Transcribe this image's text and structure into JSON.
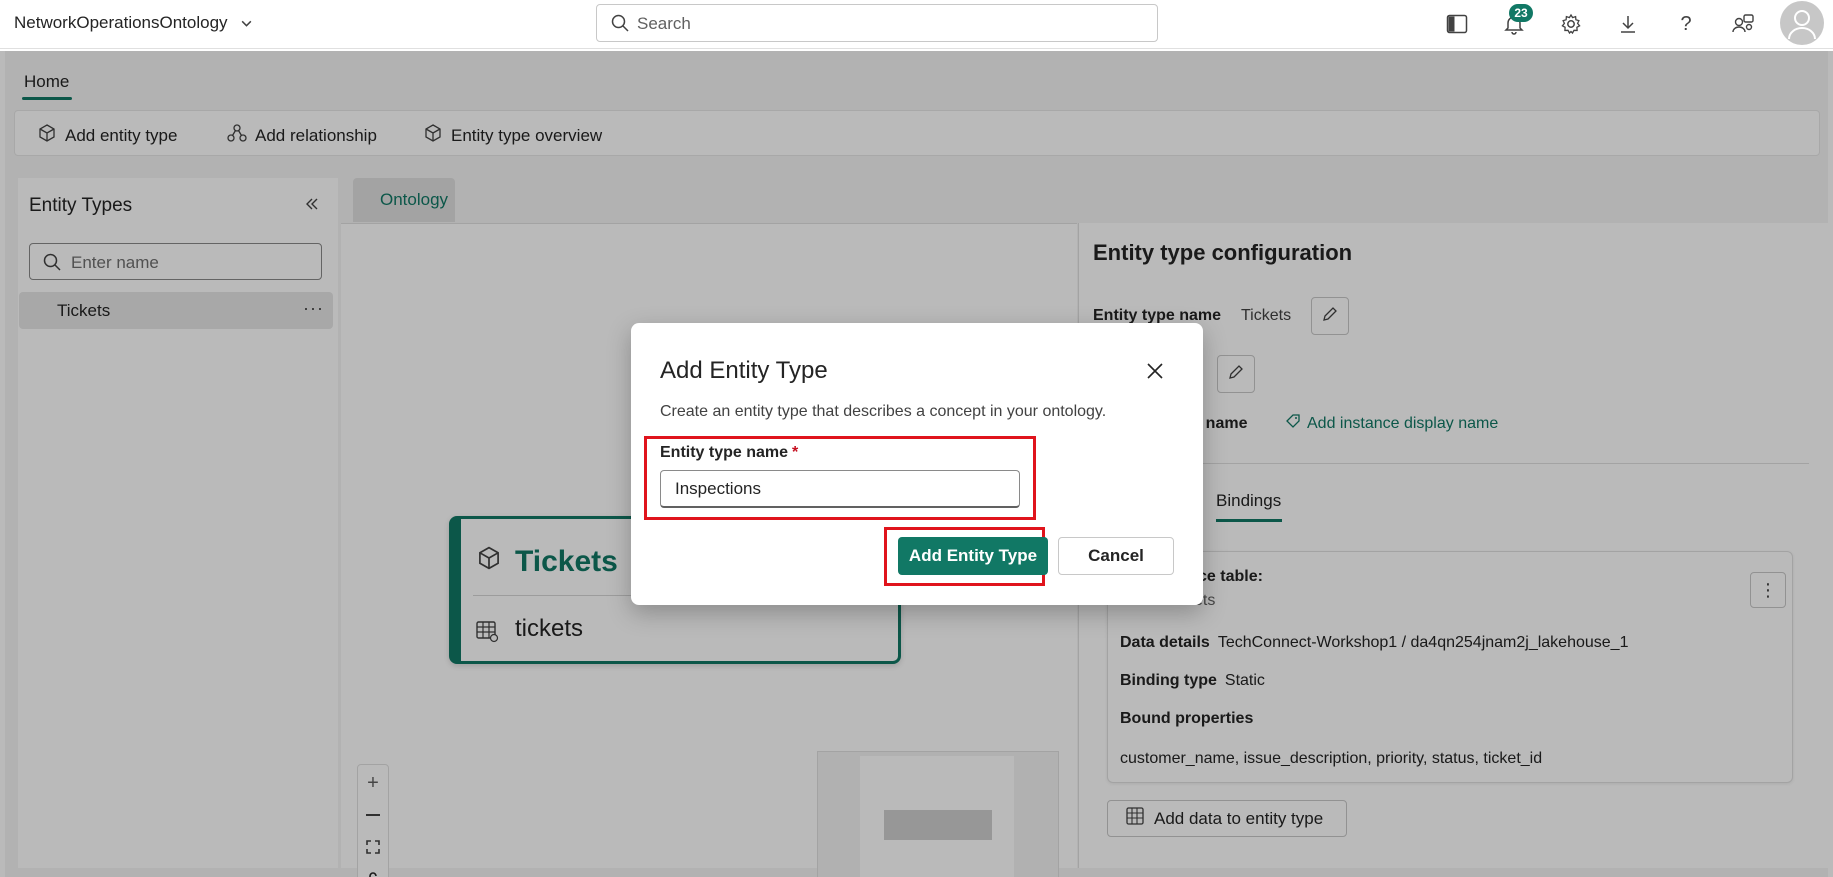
{
  "topbar": {
    "workspace_name": "NetworkOperationsOntology",
    "search_placeholder": "Search",
    "notification_count": "23",
    "icons": [
      "sidebar-toggle-icon",
      "bell-icon",
      "gear-icon",
      "download-icon",
      "help-icon",
      "share-people-icon",
      "avatar-icon"
    ]
  },
  "tabs": {
    "home": "Home"
  },
  "ribbon": {
    "add_entity_type": "Add entity type",
    "add_relationship": "Add relationship",
    "entity_type_overview": "Entity type overview"
  },
  "left_panel": {
    "title": "Entity Types",
    "search_placeholder": "Enter name",
    "items": [
      {
        "label": "Tickets",
        "more": "···"
      }
    ]
  },
  "canvas": {
    "tab_label": "Ontology",
    "node": {
      "title": "Tickets",
      "table": "tickets"
    }
  },
  "config": {
    "title": "Entity type configuration",
    "entity_type_name_label": "Entity type name",
    "entity_type_name_value": "Tickets",
    "display_name_label": "ty name",
    "add_display_name": "Add instance display name",
    "bindings_tab": "Bindings",
    "source_table_label": "ce table:",
    "source_table_value": "tickets",
    "data_details_label": "Data details",
    "data_details_value": "TechConnect-Workshop1 / da4qn254jnam2j_lakehouse_1",
    "binding_type_label": "Binding type",
    "binding_type_value": "Static",
    "bound_properties_label": "Bound properties",
    "bound_properties_value": "customer_name, issue_description, priority, status, ticket_id",
    "add_data_button": "Add data to entity type"
  },
  "dialog": {
    "title": "Add Entity Type",
    "description": "Create an entity type that describes a concept in your ontology.",
    "field_label": "Entity type name",
    "required_mark": "*",
    "field_value": "Inspections",
    "primary_button": "Add Entity Type",
    "cancel_button": "Cancel"
  },
  "colors": {
    "accent": "#117865",
    "highlight": "#e0141c"
  }
}
